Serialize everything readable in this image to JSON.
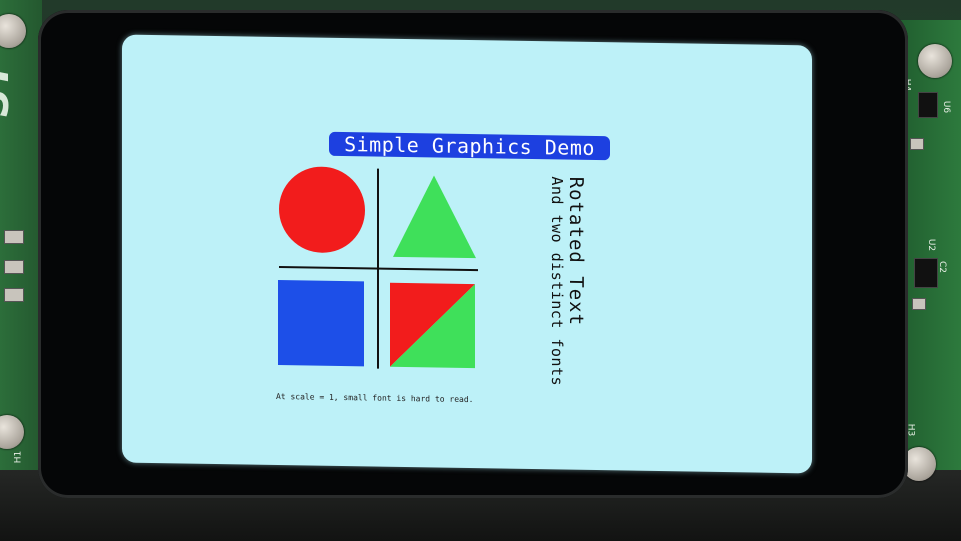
{
  "screen": {
    "title": "Simple Graphics Demo",
    "rotated_text_large": "Rotated Text",
    "rotated_text_small": "And two distinct fonts",
    "caption": "At scale = 1, small font is hard to read."
  },
  "board": {
    "labels": [
      "H4",
      "U6",
      "U2",
      "C2",
      "H1",
      "H3"
    ],
    "logo": "ST"
  },
  "colors": {
    "screen_background": "#bdf1f8",
    "title_background": "#1d40e0",
    "red": "#f21c1c",
    "green": "#3fe05a",
    "blue": "#1d4fe8",
    "line": "#111111"
  },
  "shapes": [
    {
      "name": "red-circle",
      "color": "red"
    },
    {
      "name": "green-triangle",
      "color": "green"
    },
    {
      "name": "blue-square",
      "color": "blue"
    },
    {
      "name": "red-green-split-square",
      "color": "red/green"
    }
  ]
}
